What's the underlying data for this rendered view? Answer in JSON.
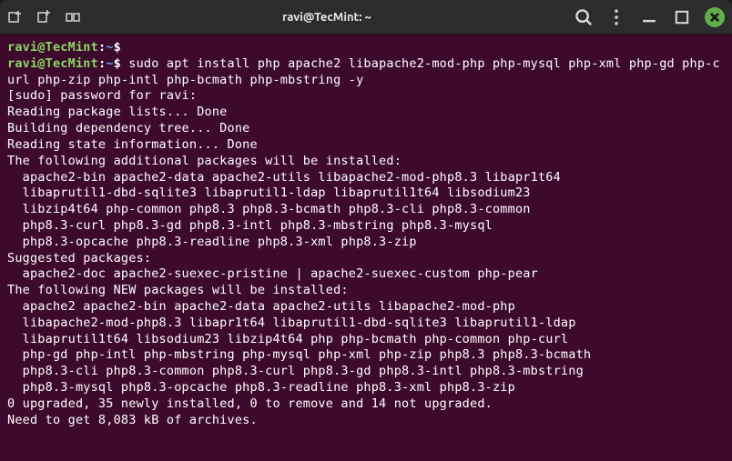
{
  "title": "ravi@TecMint: ~",
  "prompt": {
    "user": "ravi@TecMint",
    "path": "~",
    "symbol": "$"
  },
  "command": "sudo apt install php apache2 libapache2-mod-php php-mysql php-xml php-gd php-curl php-zip php-intl php-bcmath php-mbstring -y",
  "output_lines": [
    "[sudo] password for ravi:",
    "Reading package lists... Done",
    "Building dependency tree... Done",
    "Reading state information... Done",
    "The following additional packages will be installed:",
    "  apache2-bin apache2-data apache2-utils libapache2-mod-php8.3 libapr1t64",
    "  libaprutil1-dbd-sqlite3 libaprutil1-ldap libaprutil1t64 libsodium23",
    "  libzip4t64 php-common php8.3 php8.3-bcmath php8.3-cli php8.3-common",
    "  php8.3-curl php8.3-gd php8.3-intl php8.3-mbstring php8.3-mysql",
    "  php8.3-opcache php8.3-readline php8.3-xml php8.3-zip",
    "Suggested packages:",
    "  apache2-doc apache2-suexec-pristine | apache2-suexec-custom php-pear",
    "The following NEW packages will be installed:",
    "  apache2 apache2-bin apache2-data apache2-utils libapache2-mod-php",
    "  libapache2-mod-php8.3 libapr1t64 libaprutil1-dbd-sqlite3 libaprutil1-ldap",
    "  libaprutil1t64 libsodium23 libzip4t64 php php-bcmath php-common php-curl",
    "  php-gd php-intl php-mbstring php-mysql php-xml php-zip php8.3 php8.3-bcmath",
    "  php8.3-cli php8.3-common php8.3-curl php8.3-gd php8.3-intl php8.3-mbstring",
    "  php8.3-mysql php8.3-opcache php8.3-readline php8.3-xml php8.3-zip",
    "0 upgraded, 35 newly installed, 0 to remove and 14 not upgraded.",
    "Need to get 8,083 kB of archives."
  ]
}
